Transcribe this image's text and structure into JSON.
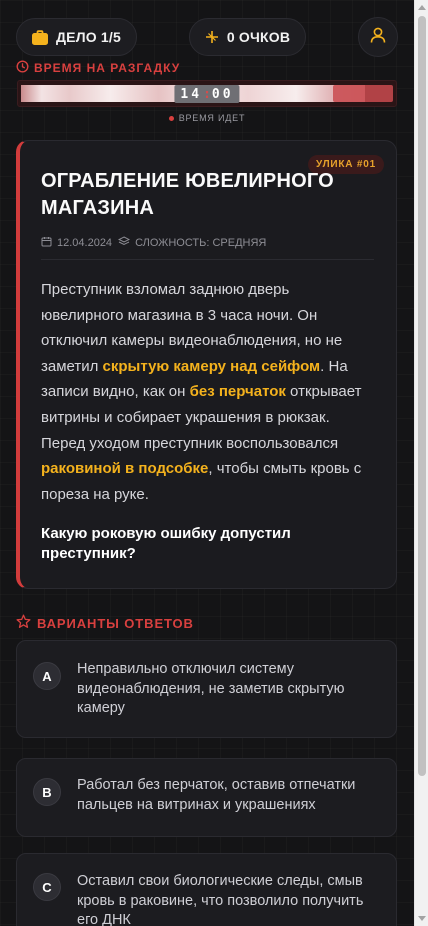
{
  "header": {
    "case_counter": "ДЕЛО 1/5",
    "score": "0 ОЧКОВ"
  },
  "timer": {
    "label": "ВРЕМЯ НА РАЗГАДКУ",
    "minutes": "14",
    "seconds": "00",
    "status": "ВРЕМЯ ИДЕТ",
    "remaining_fraction": 1.0
  },
  "case": {
    "badge": "УЛИКА #01",
    "title": "ОГРАБЛЕНИЕ ЮВЕЛИРНОГО МАГАЗИНА",
    "date": "12.04.2024",
    "difficulty": "СЛОЖНОСТЬ: СРЕДНЯЯ",
    "text_1": "Преступник взломал заднюю дверь ювелирного магазина в 3 часа ночи. Он отключил камеры видеонаблюдения, но не заметил ",
    "clue_1": "скрытую камеру над сейфом",
    "text_2": ". На записи видно, как он ",
    "clue_2": "без перчаток",
    "text_3": " открывает витрины и собирает украшения в рюкзак. Перед уходом преступник воспользовался ",
    "clue_3": "раковиной в подсобке",
    "text_4": ", чтобы смыть кровь с пореза на руке.",
    "question": "Какую роковую ошибку допустил преступник?"
  },
  "answers": {
    "label": "ВАРИАНТЫ ОТВЕТОВ",
    "items": [
      {
        "letter": "A",
        "text": "Неправильно отключил систему видеонаблюдения, не заметив скрытую камеру"
      },
      {
        "letter": "B",
        "text": "Работал без перчаток, оставив отпечатки пальцев на витринах и украшениях"
      },
      {
        "letter": "C",
        "text": "Оставил свои биологические следы, смыв кровь в раковине, что позволило получить его ДНК"
      }
    ]
  },
  "colors": {
    "accent_red": "#d8403f",
    "highlight_yellow": "#f4b21d",
    "background": "#141416",
    "card": "#1b1b1f"
  },
  "icons": {
    "case": "briefcase-icon",
    "score": "crosshair-icon",
    "user": "user-icon",
    "timer": "clock-icon",
    "date": "calendar-icon",
    "difficulty": "layers-icon",
    "answers": "star-icon"
  }
}
